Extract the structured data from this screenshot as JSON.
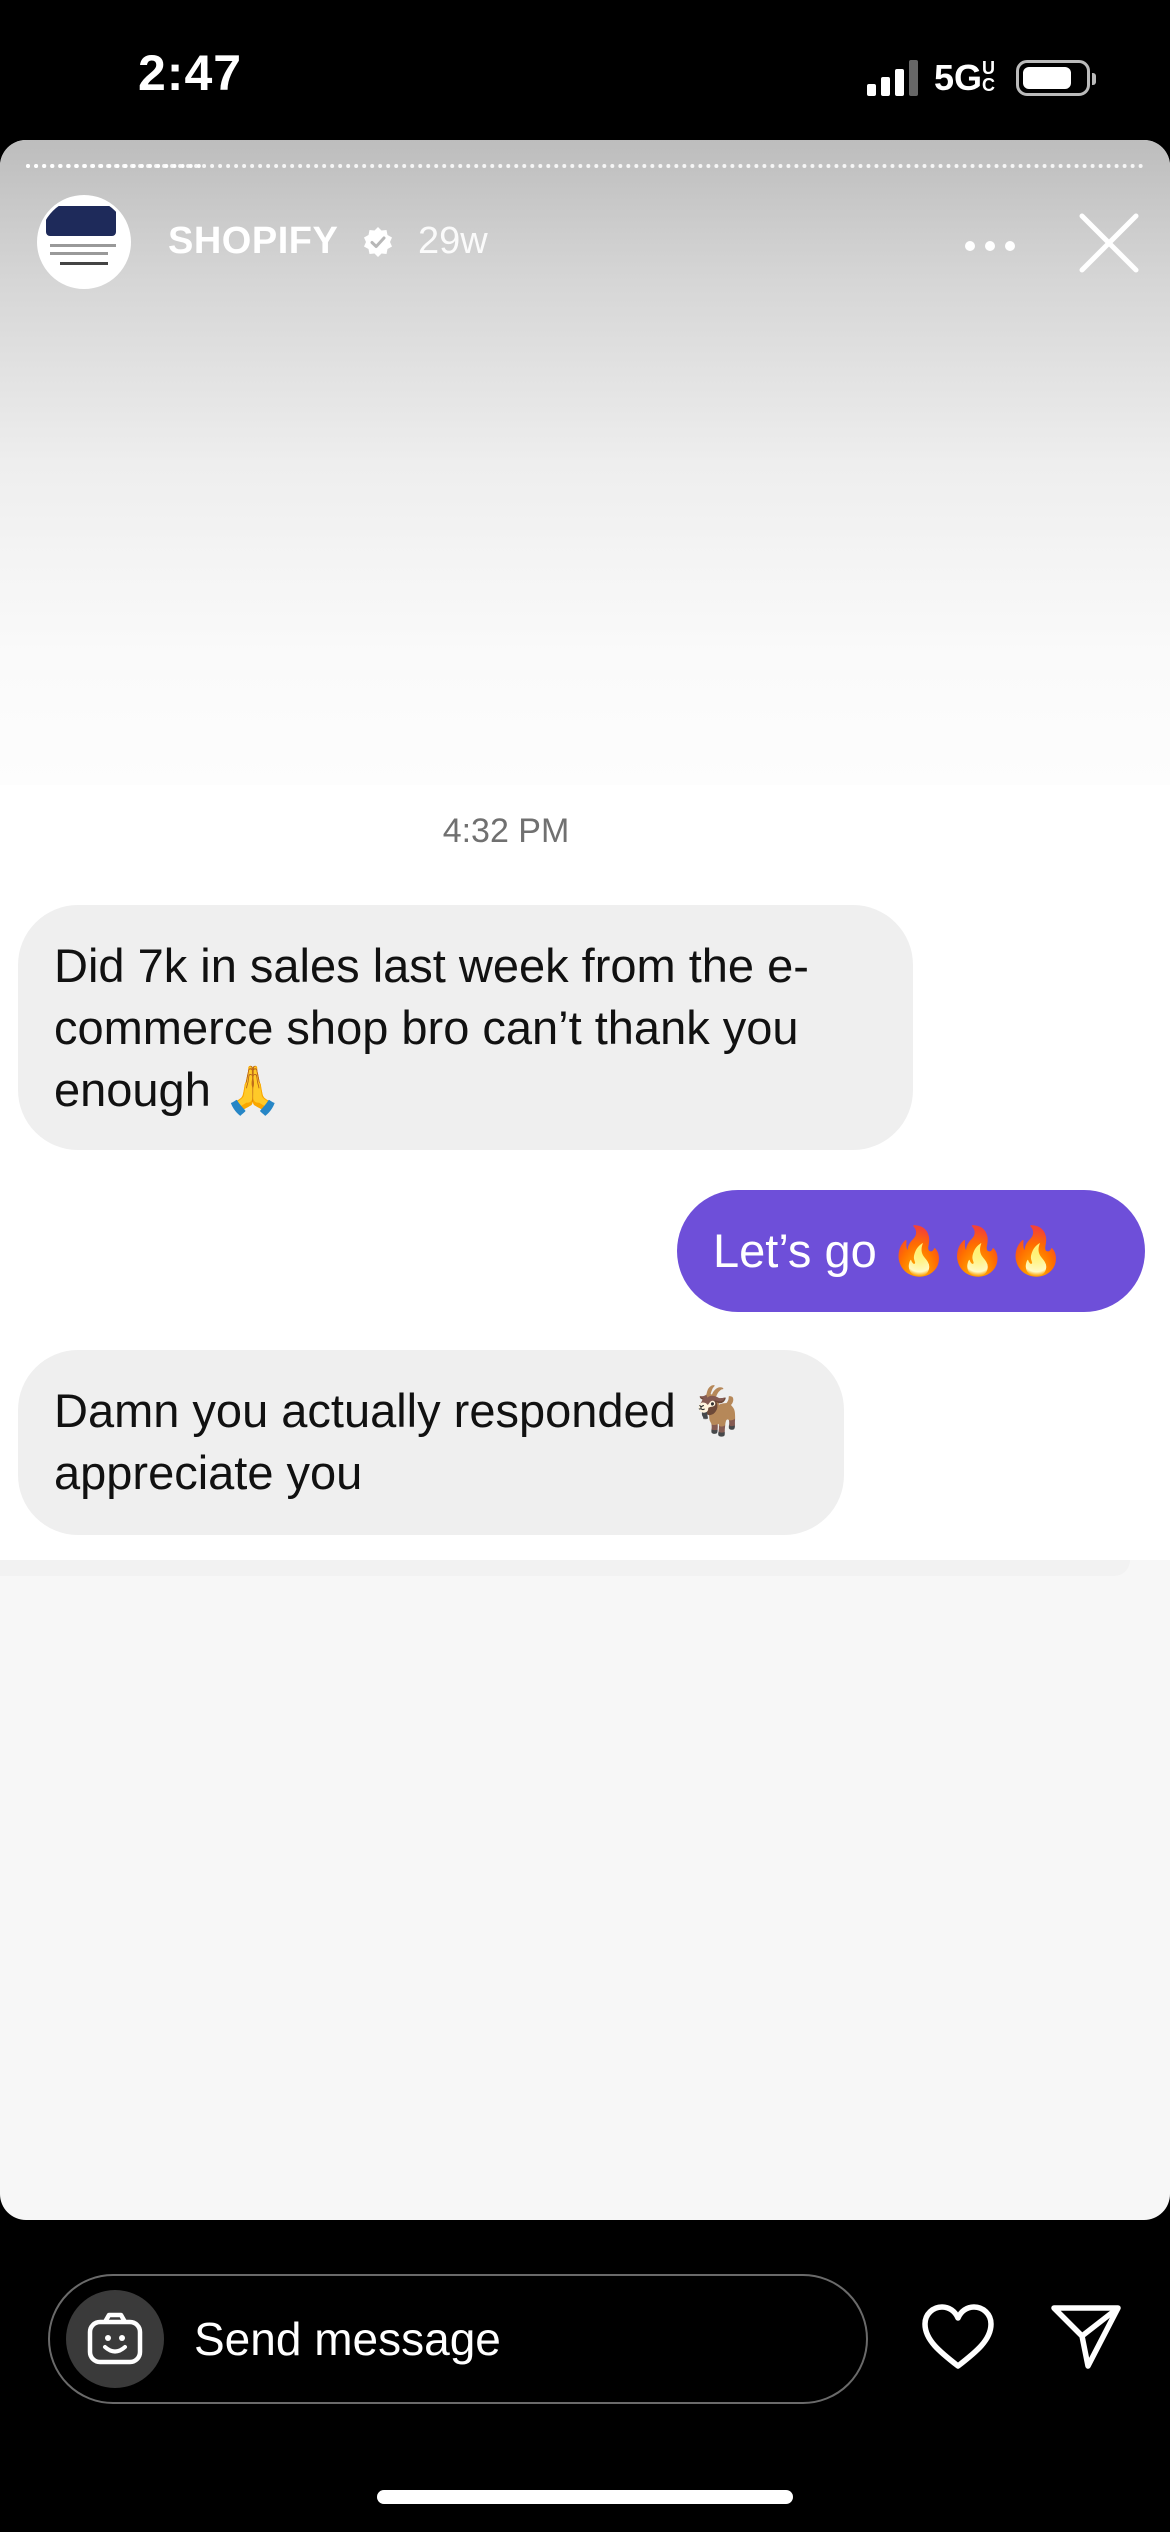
{
  "status_bar": {
    "time": "2:47",
    "network": "5G",
    "network_suffix": "UC"
  },
  "story": {
    "author": "SHOPIFY",
    "age": "29w",
    "verified": true
  },
  "chat": {
    "timestamp": "4:32 PM",
    "messages": [
      {
        "side": "incoming",
        "text": "Did 7k in sales last week from the e-commerce shop bro can’t thank you enough 🙏"
      },
      {
        "side": "outgoing",
        "text": "Let’s go 🔥🔥🔥"
      },
      {
        "side": "incoming",
        "text": "Damn you actually responded 🐐 appreciate you"
      }
    ],
    "outgoing_color": "#6e4fd9",
    "incoming_color": "#efefef"
  },
  "composer": {
    "placeholder": "Send message"
  },
  "icons": {
    "more": "more-dots-icon",
    "close": "close-icon",
    "verified": "verified-badge-icon",
    "camera": "camera-icon",
    "heart": "heart-icon",
    "send": "send-icon"
  }
}
